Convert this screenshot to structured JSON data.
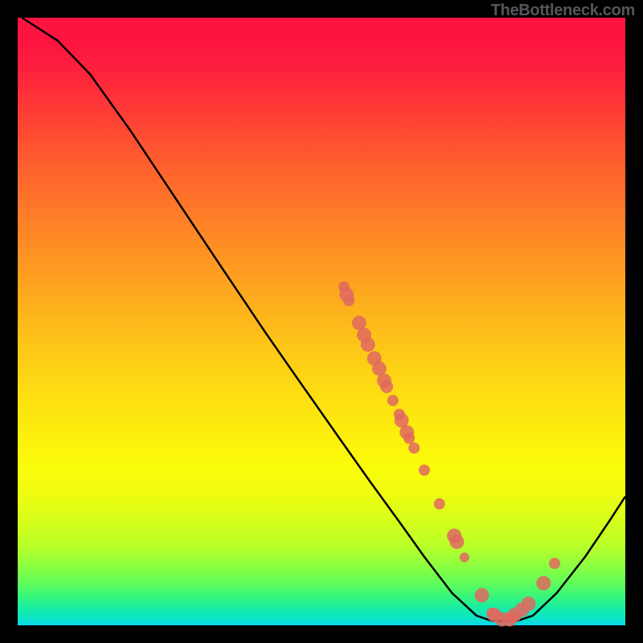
{
  "attribution": "TheBottleneck.com",
  "chart_data": {
    "type": "line",
    "title": "",
    "xlabel": "",
    "ylabel": "",
    "xlim": [
      0,
      100
    ],
    "ylim": [
      0,
      100
    ],
    "grid": false,
    "legend": false,
    "series": [
      {
        "name": "curve",
        "points": [
          {
            "x": 0.7,
            "y": 100
          },
          {
            "x": 6.6,
            "y": 96.2
          },
          {
            "x": 11.9,
            "y": 90.7
          },
          {
            "x": 18.5,
            "y": 81.5
          },
          {
            "x": 26.5,
            "y": 69.5
          },
          {
            "x": 33.1,
            "y": 59.6
          },
          {
            "x": 40.7,
            "y": 48.3
          },
          {
            "x": 46.4,
            "y": 40.1
          },
          {
            "x": 53.0,
            "y": 30.7
          },
          {
            "x": 57.9,
            "y": 23.8
          },
          {
            "x": 62.9,
            "y": 16.9
          },
          {
            "x": 66.9,
            "y": 11.3
          },
          {
            "x": 71.5,
            "y": 5.3
          },
          {
            "x": 75.5,
            "y": 1.6
          },
          {
            "x": 78.1,
            "y": 0.7
          },
          {
            "x": 82.1,
            "y": 0.7
          },
          {
            "x": 84.8,
            "y": 1.6
          },
          {
            "x": 88.7,
            "y": 5.3
          },
          {
            "x": 93.4,
            "y": 11.3
          },
          {
            "x": 97.4,
            "y": 17.2
          },
          {
            "x": 100,
            "y": 21.2
          }
        ]
      }
    ],
    "scatter": [
      {
        "x": 54.3,
        "y": 56.3,
        "r": 7
      },
      {
        "x": 55.0,
        "y": 55.0,
        "r": 9
      },
      {
        "x": 55.6,
        "y": 54.0,
        "r": 7
      },
      {
        "x": 58.3,
        "y": 50.3,
        "r": 9
      },
      {
        "x": 59.6,
        "y": 48.3,
        "r": 9
      },
      {
        "x": 60.6,
        "y": 46.7,
        "r": 9
      },
      {
        "x": 62.3,
        "y": 44.4,
        "r": 9
      },
      {
        "x": 63.6,
        "y": 42.7,
        "r": 9
      },
      {
        "x": 64.9,
        "y": 40.7,
        "r": 9
      },
      {
        "x": 65.6,
        "y": 39.7,
        "r": 8
      },
      {
        "x": 67.2,
        "y": 37.4,
        "r": 7
      },
      {
        "x": 68.9,
        "y": 35.1,
        "r": 7
      },
      {
        "x": 69.5,
        "y": 34.1,
        "r": 9
      },
      {
        "x": 70.9,
        "y": 32.1,
        "r": 9
      },
      {
        "x": 71.5,
        "y": 31.1,
        "r": 7
      },
      {
        "x": 72.8,
        "y": 29.5,
        "r": 7
      },
      {
        "x": 75.5,
        "y": 25.8,
        "r": 7
      },
      {
        "x": 79.5,
        "y": 20.2,
        "r": 7
      },
      {
        "x": 83.4,
        "y": 14.9,
        "r": 9
      },
      {
        "x": 84.1,
        "y": 13.9,
        "r": 9
      },
      {
        "x": 86.1,
        "y": 11.3,
        "r": 6
      },
      {
        "x": 90.7,
        "y": 5.0,
        "r": 9
      },
      {
        "x": 93.4,
        "y": 2.0,
        "r": 7
      },
      {
        "x": 94.0,
        "y": 1.7,
        "r": 9
      },
      {
        "x": 96.0,
        "y": 1.0,
        "r": 9
      },
      {
        "x": 98.0,
        "y": 1.0,
        "r": 9
      },
      {
        "x": 98.7,
        "y": 1.3,
        "r": 6
      },
      {
        "x": 99.3,
        "y": 1.7,
        "r": 9
      },
      {
        "x": 101.3,
        "y": 2.6,
        "r": 9
      },
      {
        "x": 103.0,
        "y": 3.6,
        "r": 9
      },
      {
        "x": 107.0,
        "y": 7.0,
        "r": 9
      },
      {
        "x": 109.9,
        "y": 10.3,
        "r": 7
      }
    ]
  }
}
